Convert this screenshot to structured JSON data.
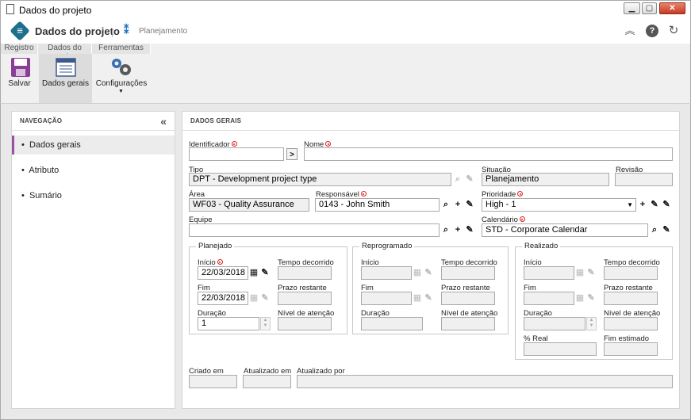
{
  "window": {
    "title": "Dados do projeto"
  },
  "header": {
    "app_title": "Dados do projeto",
    "separator": "|",
    "breadcrumb": "Planejamento"
  },
  "ribbon": {
    "tabs": [
      "Registro",
      "Dados do regi...",
      "Ferramentas"
    ],
    "buttons": {
      "save": "Salvar",
      "general": "Dados gerais",
      "settings": "Configurações"
    }
  },
  "nav": {
    "title": "NAVEGAÇÃO",
    "collapse": "«",
    "items": [
      {
        "label": "Dados gerais",
        "active": true
      },
      {
        "label": "Atributo"
      },
      {
        "label": "Sumário"
      }
    ]
  },
  "form": {
    "title": "DADOS GERAIS",
    "identificador": {
      "label": "Identificador",
      "value": ""
    },
    "nome": {
      "label": "Nome",
      "value": ""
    },
    "tipo": {
      "label": "Tipo",
      "value": "DPT - Development project type"
    },
    "situacao": {
      "label": "Situação",
      "value": "Planejamento"
    },
    "revisao": {
      "label": "Revisão",
      "value": ""
    },
    "area": {
      "label": "Área",
      "value": "WF03 - Quality Assurance"
    },
    "responsavel": {
      "label": "Responsável",
      "value": "0143 - John Smith"
    },
    "prioridade": {
      "label": "Prioridade",
      "value": "High - 1"
    },
    "equipe": {
      "label": "Equipe",
      "value": ""
    },
    "calendario": {
      "label": "Calendário",
      "value": "STD - Corporate Calendar"
    },
    "planejado": {
      "legend": "Planejado",
      "inicio": {
        "label": "Início",
        "value": "22/03/2018"
      },
      "fim": {
        "label": "Fim",
        "value": "22/03/2018"
      },
      "duracao": {
        "label": "Duração",
        "value": "1"
      },
      "tempo_decorrido": {
        "label": "Tempo decorrido",
        "value": ""
      },
      "prazo_restante": {
        "label": "Prazo restante",
        "value": ""
      },
      "nivel_atencao": {
        "label": "Nível de atenção",
        "value": ""
      }
    },
    "reprogramado": {
      "legend": "Reprogramado",
      "inicio": {
        "label": "Início"
      },
      "fim": {
        "label": "Fim"
      },
      "duracao": {
        "label": "Duração"
      },
      "tempo_decorrido": {
        "label": "Tempo decorrido"
      },
      "prazo_restante": {
        "label": "Prazo restante"
      },
      "nivel_atencao": {
        "label": "Nível de atenção"
      }
    },
    "realizado": {
      "legend": "Realizado",
      "inicio": {
        "label": "Início"
      },
      "fim": {
        "label": "Fim"
      },
      "duracao": {
        "label": "Duração"
      },
      "tempo_decorrido": {
        "label": "Tempo decorrido"
      },
      "prazo_restante": {
        "label": "Prazo restante"
      },
      "nivel_atencao": {
        "label": "Nível de atenção"
      },
      "real": {
        "label": "% Real"
      },
      "fim_estimado": {
        "label": "Fim estimado"
      }
    },
    "criado_em": {
      "label": "Criado em"
    },
    "atualizado_em": {
      "label": "Atualizado em"
    },
    "atualizado_por": {
      "label": "Atualizado por"
    }
  },
  "colors": {
    "accent": "#9b4fa5",
    "logo": "#1e6f8c",
    "required": "#e02020"
  }
}
